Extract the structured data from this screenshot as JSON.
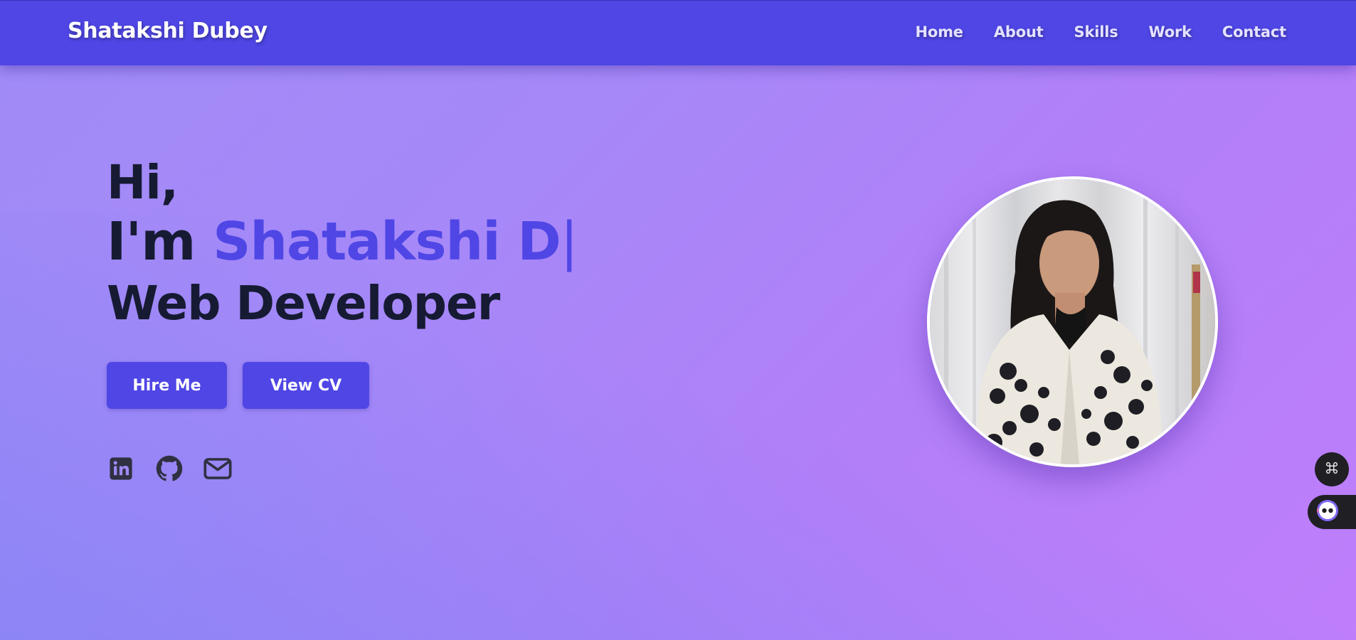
{
  "brand": {
    "name": "Shatakshi Dubey"
  },
  "nav": {
    "items": [
      {
        "label": "Home"
      },
      {
        "label": "About"
      },
      {
        "label": "Skills"
      },
      {
        "label": "Work"
      },
      {
        "label": "Contact"
      }
    ]
  },
  "hero": {
    "greeting": "Hi,",
    "intro_prefix": "I'm ",
    "typed_name": "Shatakshi D",
    "cursor": "|",
    "role": "Web Developer",
    "hire_button": "Hire Me",
    "cv_button": "View CV"
  },
  "socials": [
    {
      "icon": "linkedin-icon"
    },
    {
      "icon": "github-icon"
    },
    {
      "icon": "mail-icon"
    }
  ],
  "floating": {
    "command_icon": "command-icon",
    "assistant_icon": "robot-face-icon"
  },
  "colors": {
    "primary": "#4f46e5",
    "heading": "#161b33",
    "social_icon": "#2f3142",
    "bg_start": "#a08bf6",
    "bg_end": "#bf7efb",
    "floating_bg": "#1f1f24"
  }
}
